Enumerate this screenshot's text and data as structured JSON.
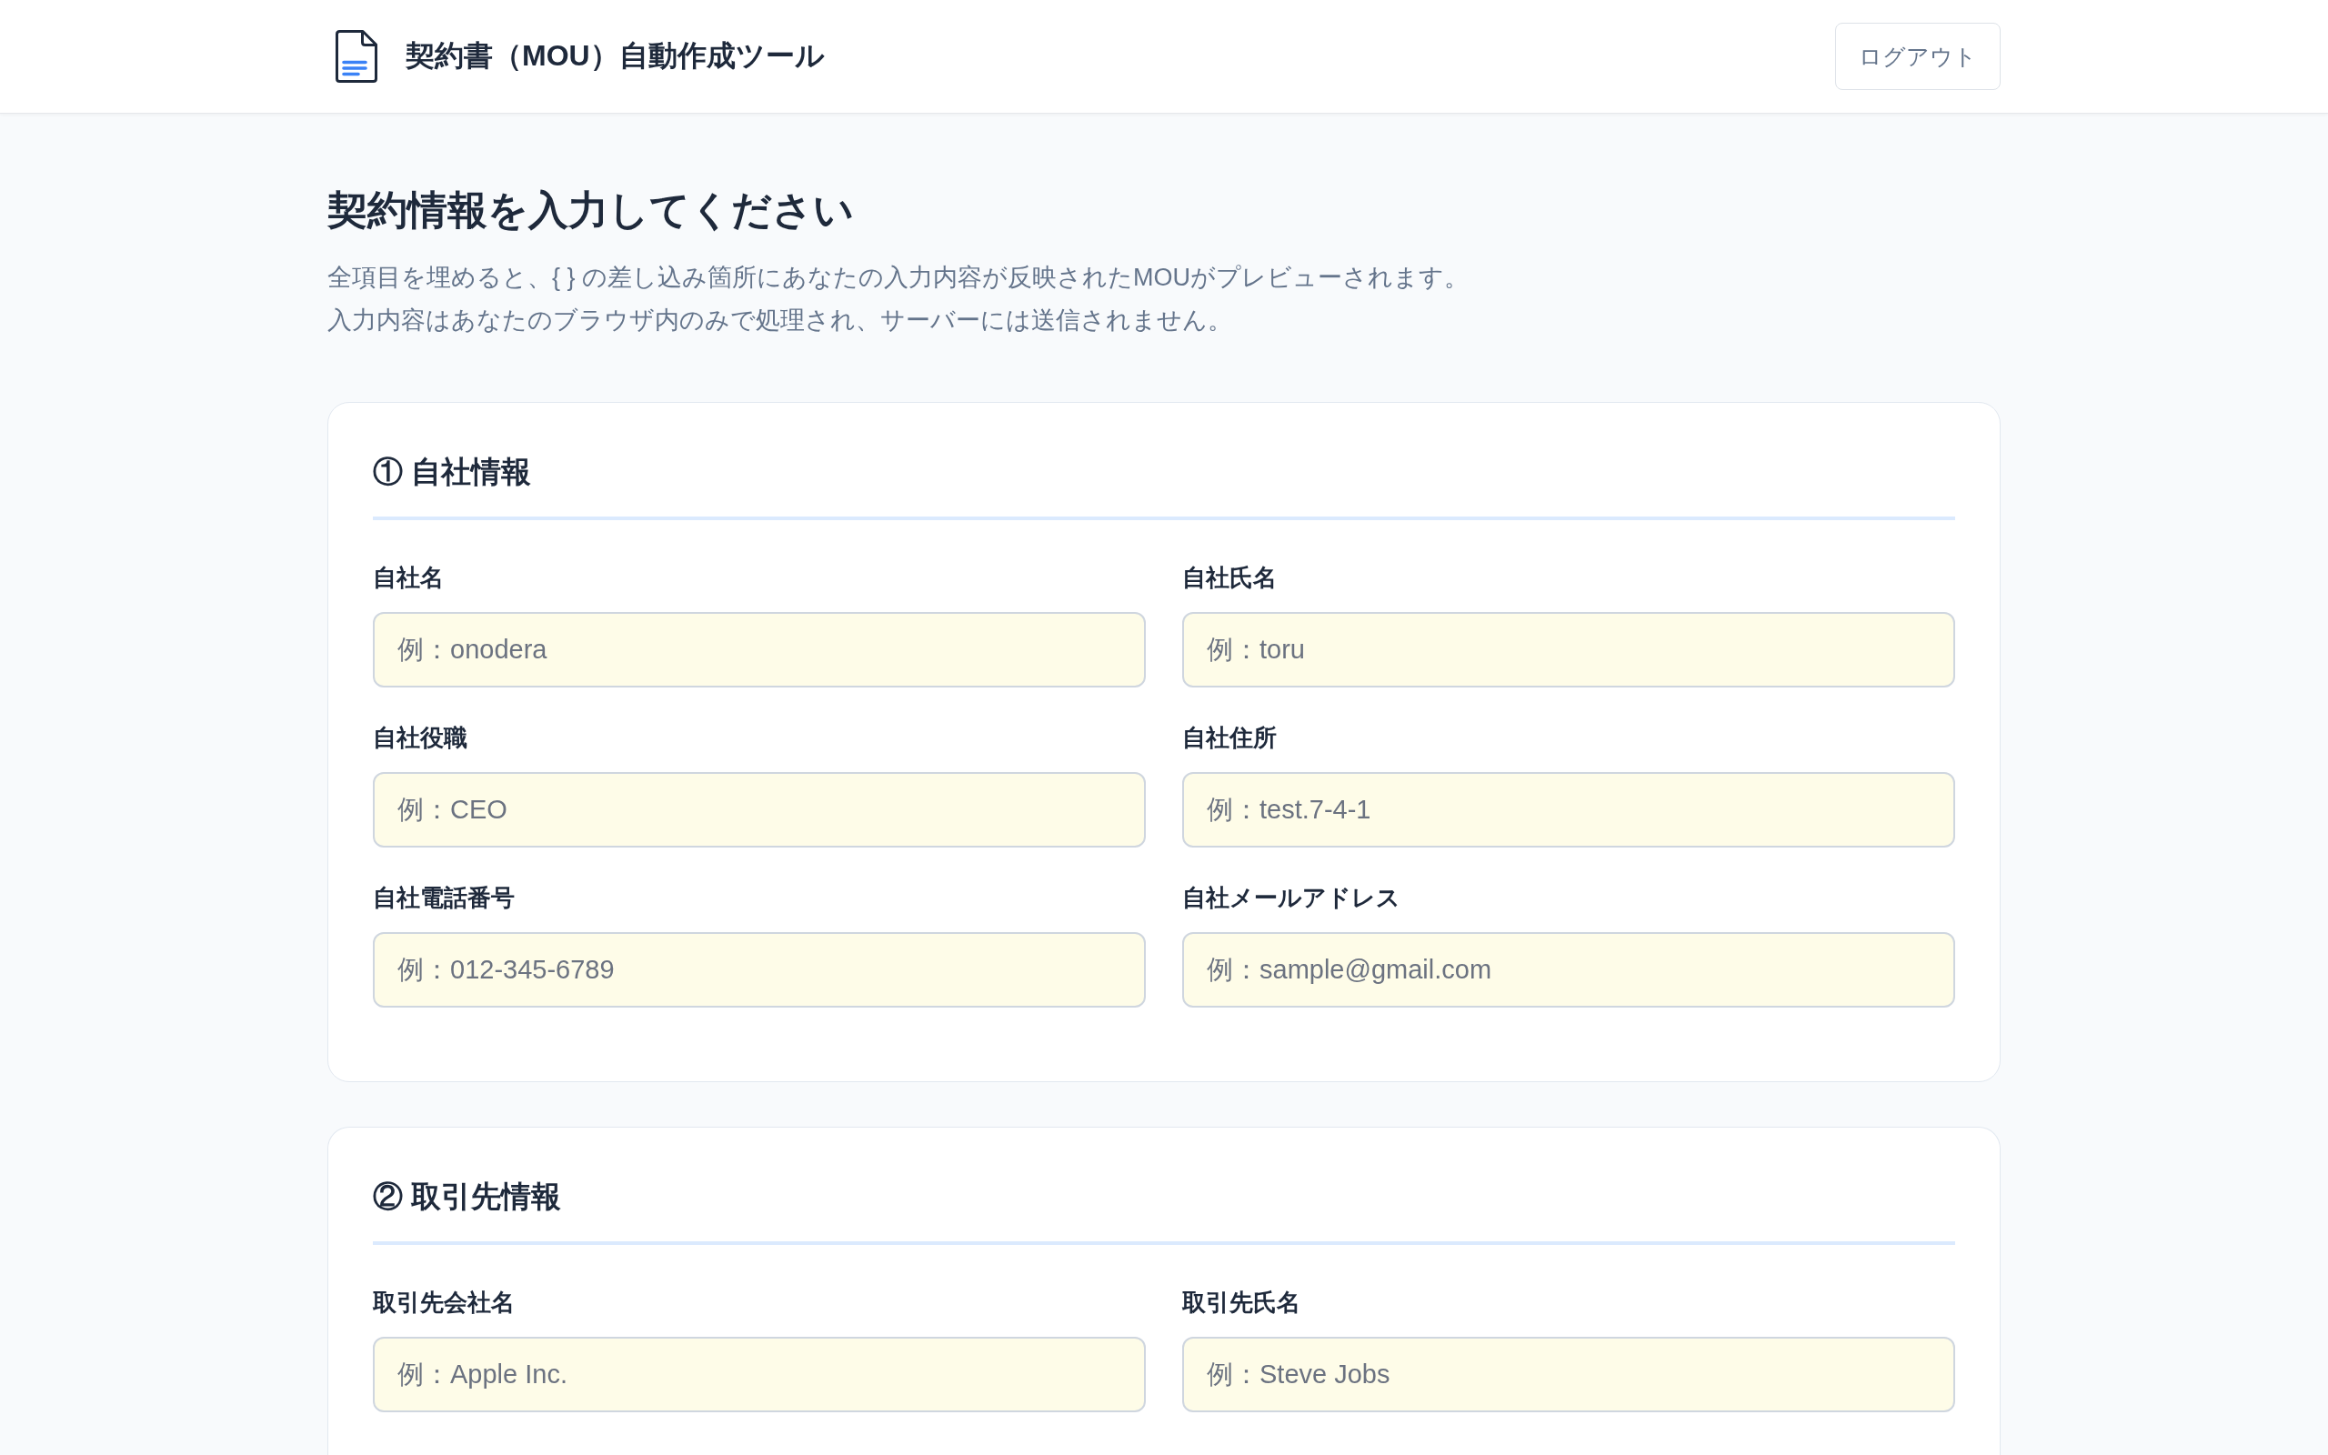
{
  "header": {
    "title": "契約書（MOU）自動作成ツール",
    "logout_button": "ログアウト"
  },
  "intro": {
    "heading": "契約情報を入力してください",
    "description": [
      "全項目を埋めると、{ } の差し込み箇所にあなたの入力内容が反映されたMOUがプレビューされます。",
      "入力内容はあなたのブラウザ内のみで処理され、サーバーには送信されません。"
    ]
  },
  "sections": [
    {
      "title": "① 自社情報",
      "fields": [
        {
          "label": "自社名",
          "placeholder": "例：onodera"
        },
        {
          "label": "自社氏名",
          "placeholder": "例：toru"
        },
        {
          "label": "自社役職",
          "placeholder": "例：CEO"
        },
        {
          "label": "自社住所",
          "placeholder": "例：test.7-4-1"
        },
        {
          "label": "自社電話番号",
          "placeholder": "例：012-345-6789"
        },
        {
          "label": "自社メールアドレス",
          "placeholder": "例：sample@gmail.com"
        }
      ]
    },
    {
      "title": "② 取引先情報",
      "fields": [
        {
          "label": "取引先会社名",
          "placeholder": "例：Apple Inc."
        },
        {
          "label": "取引先氏名",
          "placeholder": "例：Steve Jobs"
        }
      ]
    }
  ]
}
